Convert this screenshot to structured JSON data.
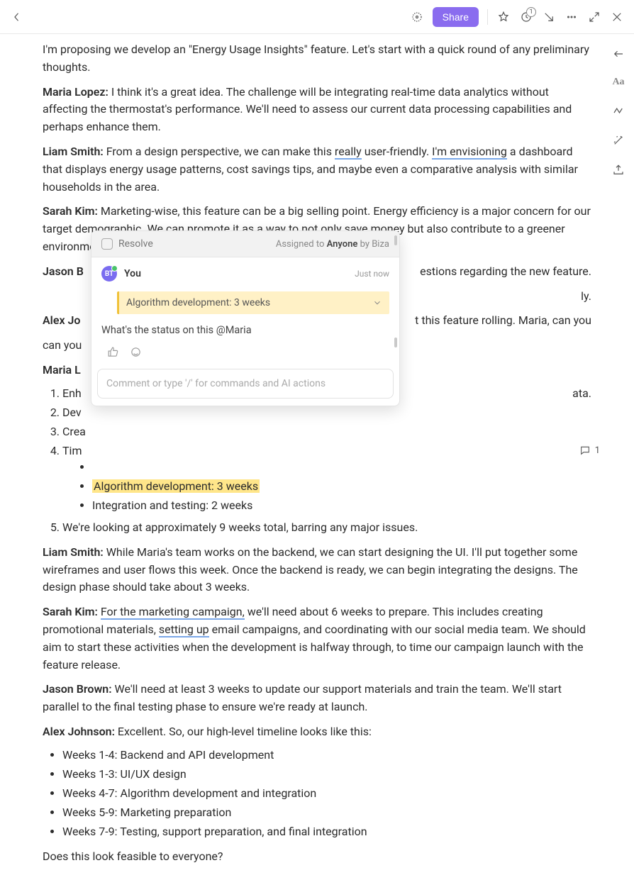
{
  "topbar": {
    "share": "Share"
  },
  "right_rail": {
    "aa": "Aa"
  },
  "content": {
    "intro_tail": "I'm proposing we develop an \"Energy Usage Insights\" feature. Let's start with a quick round of any preliminary thoughts.",
    "maria1_sp": "Maria Lopez:",
    "maria1": " I think it's a great idea. The challenge will be integrating real-time data analytics without affecting the thermostat's performance. We'll need to assess our current data processing capabilities and perhaps enhance them.",
    "liam1_sp": "Liam Smith:",
    "liam1_a": " From a design perspective, we can make this ",
    "liam1_really": "really",
    "liam1_b": " user-friendly. ",
    "liam1_env": "I'm envisioning",
    "liam1_c": " a dashboard that displays energy usage patterns, cost savings tips, and maybe even a comparative analysis with similar households in the area.",
    "sarah1_sp": "Sarah Kim:",
    "sarah1": " Marketing-wise, this feature can be a big selling point. Energy efficiency is a major concern for our target demographic. We can promote it as a way to not only save money but also contribute to a greener environment.",
    "jason1_sp": "Jason B",
    "jason1_tail": "estions regarding the new feature.",
    "jason1_tail2": "ly.",
    "alex1_sp": "Alex Jo",
    "alex1_tail": "t this feature rolling. Maria, can you",
    "maria2_sp": "Maria L",
    "li1": "Enh",
    "li1_tail": "ata.",
    "li2": "Dev",
    "li3": "Crea",
    "li4": "Tim",
    "sub_blank": " ",
    "sub_algo": "Algorithm development: 3 weeks",
    "sub_int": "Integration and testing: 2 weeks",
    "li5": "We're looking at approximately 9 weeks total, barring any major issues.",
    "liam2_sp": "Liam Smith:",
    "liam2": " While Maria's team works on the backend, we can start designing the UI. I'll put together some wireframes and user flows this week. Once the backend is ready, we can begin integrating the designs. The design phase should take about 3 weeks.",
    "sarah2_sp": "Sarah Kim:",
    "sarah2_a": " ",
    "sarah2_u1": "For the marketing campaign,",
    "sarah2_b": " we'll need about 6 weeks to prepare. This includes creating promotional materials, ",
    "sarah2_u2": "setting up",
    "sarah2_c": " email campaigns, and coordinating with our social media team. We should aim to start these activities when the development is halfway through, to time our campaign launch with the feature release.",
    "jason2_sp": "Jason Brown:",
    "jason2": " We'll need at least 3 weeks to update our support materials and train the team. We'll start parallel to the final testing phase to ensure we're ready at launch.",
    "alex2_sp": "Alex Johnson:",
    "alex2": " Excellent. So, our high-level timeline looks like this:",
    "w1_b": "Weeks 1-4:",
    "w1": " Backend and API development",
    "w2_b": "Weeks 1-3:",
    "w2": " UI/UX design",
    "w3_b": "Weeks 4-7:",
    "w3": " Algorithm development and integration",
    "w4_b": "Weeks 5-9:",
    "w4": " Marketing preparation",
    "w5_b": "Weeks 7-9:",
    "w5": " Testing, support preparation, and final integration",
    "closing": "Does this look feasible to everyone?"
  },
  "comment_count": "1",
  "popup": {
    "resolve": "Resolve",
    "assigned_pre": "Assigned to ",
    "assigned_who": "Anyone",
    "assigned_by": "  by Biza",
    "you": "You",
    "avatar": "BT",
    "when": "Just now",
    "quote": "Algorithm development: 3 weeks",
    "text": "What's the status on this @Maria",
    "placeholder": "Comment or type '/' for commands and AI actions"
  }
}
